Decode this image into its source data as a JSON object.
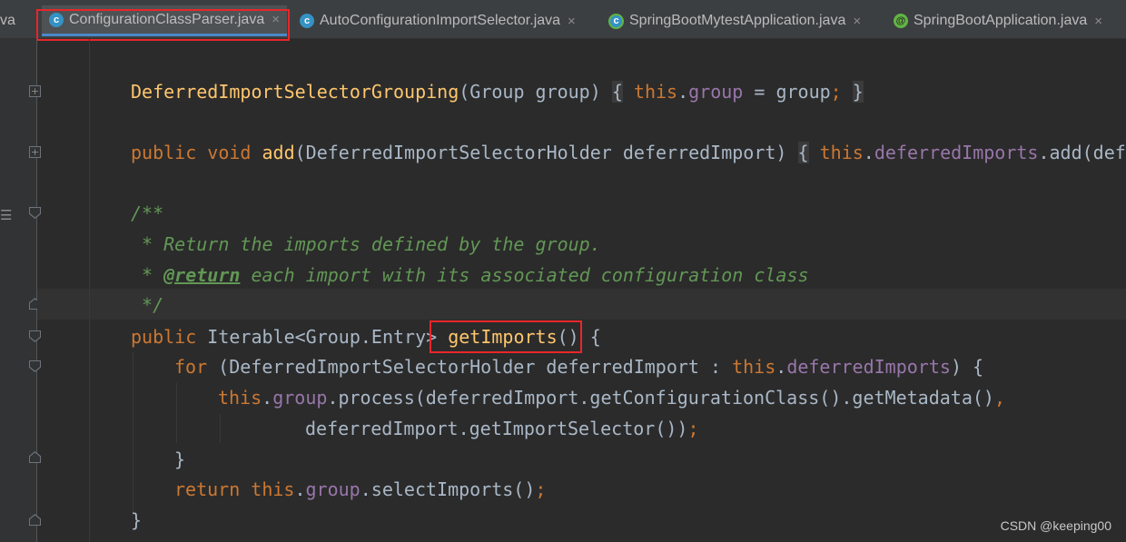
{
  "tabs": [
    {
      "label": "va",
      "partial": true
    },
    {
      "label": "ConfigurationClassParser.java",
      "icon": "class-icon",
      "active": true
    },
    {
      "label": "AutoConfigurationImportSelector.java",
      "icon": "class-icon"
    },
    {
      "label": "SpringBootMytestApplication.java",
      "icon": "spring-boot-class-icon"
    },
    {
      "label": "SpringBootApplication.java",
      "icon": "annotation-icon"
    }
  ],
  "tab_close_glyph": "×",
  "code": {
    "l1": {
      "ctor": "DeferredImportSelectorGrouping",
      "p1": "(Group group) ",
      "ob": "{",
      "sp": " ",
      "this": "this",
      "dot": ".",
      "field": "group",
      "eq": " = group",
      "semi": ";",
      "sp2": " ",
      "cb": "}"
    },
    "l2": {
      "kw1": "public",
      "kw2": " void ",
      "fn": "add",
      "p1": "(DeferredImportSelectorHolder deferredImport) ",
      "ob": "{",
      "sp": " ",
      "this": "this",
      "dot": ".",
      "field": "deferredImports",
      "rest": ".add(defe"
    },
    "l3": "/**",
    "l4": " * Return the imports defined by the group.",
    "l5a": " * ",
    "l5tag": "@return",
    "l5b": " each import with its associated configuration class",
    "l6": " */",
    "l7": {
      "kw": "public",
      "t": " Iterable<Group.Entry> ",
      "fn": "getImports",
      "p": "() {"
    },
    "l8": {
      "kw": "for",
      "p1": " (DeferredImportSelectorHolder deferredImport : ",
      "this": "this",
      "dot": ".",
      "field": "deferredImports",
      "p2": ") {"
    },
    "l9": {
      "this": "this",
      "dot": ".",
      "field": "group",
      "p1": ".process(deferredImport.getConfigurationClass().getMetadata()",
      "comma": ","
    },
    "l10": {
      "p1": "deferredImport.getImportSelector())",
      "semi": ";"
    },
    "l11": "}",
    "l12": {
      "kw": "return",
      "sp": " ",
      "this": "this",
      "dot": ".",
      "field": "group",
      "p1": ".selectImports()",
      "semi": ";"
    },
    "l13": "}"
  },
  "watermark": "CSDN @keeping00",
  "highlight_color": "#e8262b"
}
